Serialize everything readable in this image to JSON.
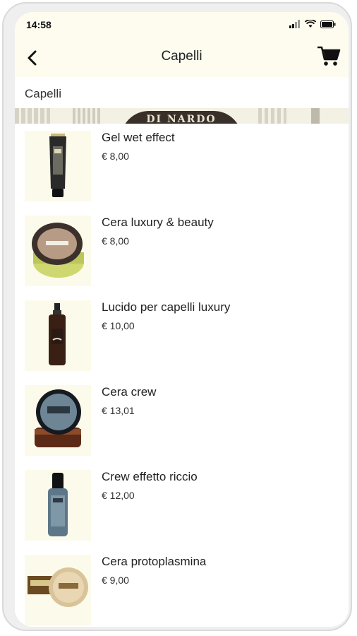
{
  "status_bar": {
    "time": "14:58"
  },
  "header": {
    "title": "Capelli",
    "back_icon": "chevron-left-icon",
    "cart_icon": "cart-icon"
  },
  "breadcrumb": {
    "label": "Capelli"
  },
  "banner": {
    "logo_text": "DI NARDO"
  },
  "products": [
    {
      "name": "Gel wet effect",
      "price": "€ 8,00"
    },
    {
      "name": "Cera luxury & beauty",
      "price": "€ 8,00"
    },
    {
      "name": "Lucido per capelli luxury",
      "price": "€ 10,00"
    },
    {
      "name": "Cera crew",
      "price": "€ 13,01"
    },
    {
      "name": "Crew effetto riccio",
      "price": "€ 12,00"
    },
    {
      "name": "Cera protoplasmina",
      "price": "€ 9,00"
    }
  ],
  "colors": {
    "header_bg": "#fdfcef",
    "thumb_bg": "#fcfbeb",
    "text": "#222222"
  }
}
